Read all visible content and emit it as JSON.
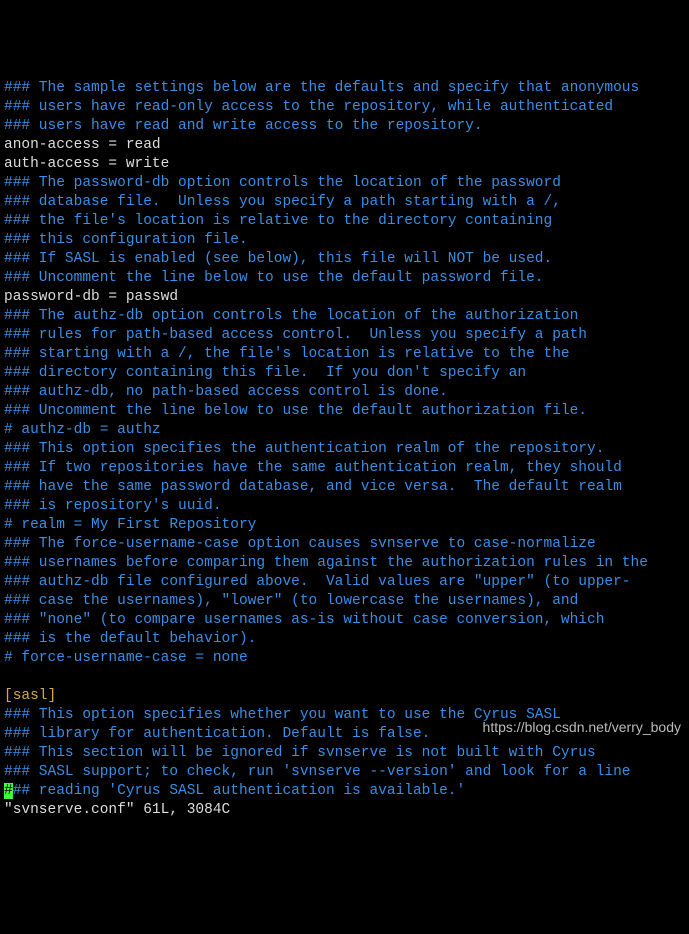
{
  "lines": [
    {
      "cls": "c",
      "t": "### The sample settings below are the defaults and specify that anonymous"
    },
    {
      "cls": "c",
      "t": "### users have read-only access to the repository, while authenticated"
    },
    {
      "cls": "c",
      "t": "### users have read and write access to the repository."
    },
    {
      "cls": "d",
      "t": "anon-access = read"
    },
    {
      "cls": "d",
      "t": "auth-access = write"
    },
    {
      "cls": "c",
      "t": "### The password-db option controls the location of the password"
    },
    {
      "cls": "c",
      "t": "### database file.  Unless you specify a path starting with a /,"
    },
    {
      "cls": "c",
      "t": "### the file's location is relative to the directory containing"
    },
    {
      "cls": "c",
      "t": "### this configuration file."
    },
    {
      "cls": "c",
      "t": "### If SASL is enabled (see below), this file will NOT be used."
    },
    {
      "cls": "c",
      "t": "### Uncomment the line below to use the default password file."
    },
    {
      "cls": "d",
      "t": "password-db = passwd"
    },
    {
      "cls": "c",
      "t": "### The authz-db option controls the location of the authorization"
    },
    {
      "cls": "c",
      "t": "### rules for path-based access control.  Unless you specify a path"
    },
    {
      "cls": "c",
      "t": "### starting with a /, the file's location is relative to the the"
    },
    {
      "cls": "c",
      "t": "### directory containing this file.  If you don't specify an"
    },
    {
      "cls": "c",
      "t": "### authz-db, no path-based access control is done."
    },
    {
      "cls": "c",
      "t": "### Uncomment the line below to use the default authorization file."
    },
    {
      "cls": "c",
      "t": "# authz-db = authz"
    },
    {
      "cls": "c",
      "t": "### This option specifies the authentication realm of the repository."
    },
    {
      "cls": "c",
      "t": "### If two repositories have the same authentication realm, they should"
    },
    {
      "cls": "c",
      "t": "### have the same password database, and vice versa.  The default realm"
    },
    {
      "cls": "c",
      "t": "### is repository's uuid."
    },
    {
      "cls": "c",
      "t": "# realm = My First Repository"
    },
    {
      "cls": "c",
      "t": "### The force-username-case option causes svnserve to case-normalize"
    },
    {
      "cls": "c",
      "t": "### usernames before comparing them against the authorization rules in the"
    },
    {
      "cls": "c",
      "t": "### authz-db file configured above.  Valid values are \"upper\" (to upper-"
    },
    {
      "cls": "c",
      "t": "### case the usernames), \"lower\" (to lowercase the usernames), and"
    },
    {
      "cls": "c",
      "t": "### \"none\" (to compare usernames as-is without case conversion, which"
    },
    {
      "cls": "c",
      "t": "### is the default behavior)."
    },
    {
      "cls": "c",
      "t": "# force-username-case = none"
    },
    {
      "cls": "d",
      "t": ""
    },
    {
      "cls": "s",
      "t": "[sasl]"
    },
    {
      "cls": "c",
      "t": "### This option specifies whether you want to use the Cyrus SASL"
    },
    {
      "cls": "c",
      "t": "### library for authentication. Default is false."
    },
    {
      "cls": "c",
      "t": "### This section will be ignored if svnserve is not built with Cyrus"
    },
    {
      "cls": "c",
      "t": "### SASL support; to check, run 'svnserve --version' and look for a line"
    }
  ],
  "cursor_line": {
    "cursor_char": "#",
    "rest": "## reading 'Cyrus SASL authentication is available.'"
  },
  "status_line": "\"svnserve.conf\" 61L, 3084C",
  "watermark": "https://blog.csdn.net/verry_body"
}
